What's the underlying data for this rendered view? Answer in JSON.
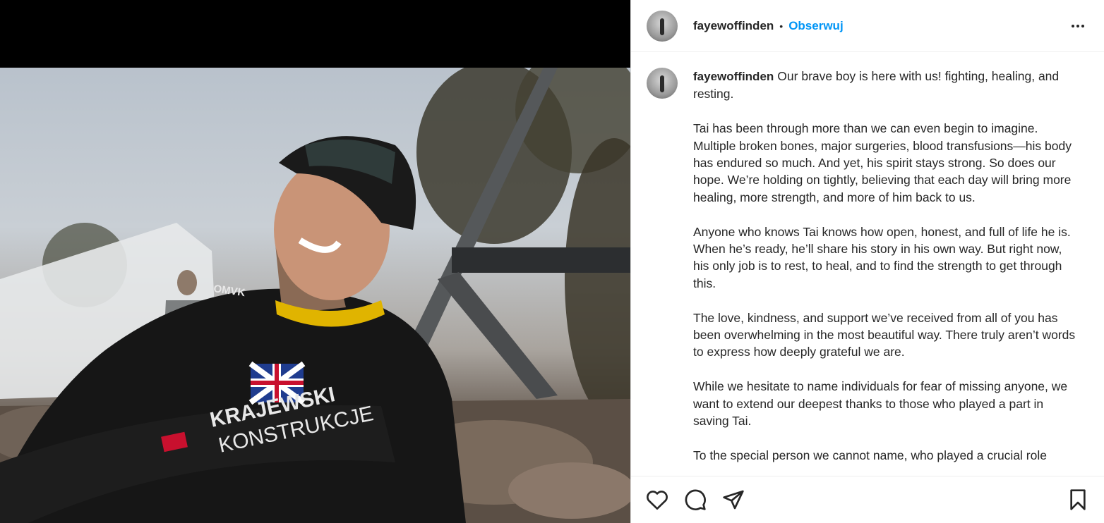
{
  "post": {
    "author": "fayewoffinden",
    "follow_label": "Obserwuj",
    "separator": "•",
    "caption_lead": "Our brave boy is here with us! fighting, healing, and resting.",
    "paragraphs": [
      "Tai has been through more than we can even begin to imagine. Multiple broken bones, major surgeries, blood transfusions—his body has endured so much. And yet, his spirit stays strong. So does our hope. We’re holding on tightly, believing that each day will bring more healing, more strength, and more of him back to us.",
      "Anyone who knows Tai knows how open, honest, and full of life he is. When he’s ready, he’ll share his story in his own way. But right now, his only job is to rest, to heal, and to find the strength to get through this.",
      "The love, kindness, and support we’ve received from all of you has been overwhelming in the most beautiful way. There truly aren’t words to express how deeply grateful we are.",
      "While we hesitate to name individuals for fear of missing anyone, we want to extend our deepest thanks to those who played a part in saving Tai.",
      "To the special person we cannot name, who played a crucial role"
    ]
  },
  "photo": {
    "suit_text_1": "KRAJEWSKI",
    "suit_text_2": "KONSTRUKCJE",
    "cap_logo": "OMVK"
  },
  "icons": {
    "more": "more-horizontal-icon",
    "like": "heart-icon",
    "comment": "comment-icon",
    "share": "send-icon",
    "save": "bookmark-icon"
  },
  "colors": {
    "follow": "#0095f6",
    "text": "#262626",
    "divider": "#efefef"
  }
}
